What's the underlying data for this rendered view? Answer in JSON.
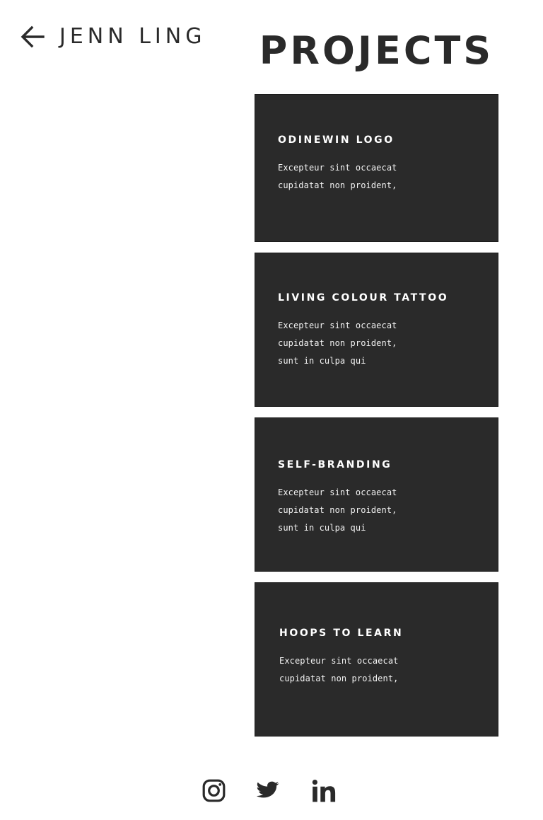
{
  "header": {
    "back_icon": "arrow-left-icon",
    "site_name": "JENN LING"
  },
  "page": {
    "title": "PROJECTS"
  },
  "projects": [
    {
      "title": "ODINEWIN LOGO",
      "description_lines": [
        "Excepteur sint occaecat",
        "cupidatat non proident,"
      ]
    },
    {
      "title": "LIVING COLOUR TATTOO",
      "description_lines": [
        "Excepteur sint occaecat",
        "cupidatat non proident,",
        "sunt in culpa qui"
      ]
    },
    {
      "title": "SELF-BRANDING",
      "description_lines": [
        "Excepteur sint occaecat",
        "cupidatat non proident,",
        "sunt in culpa qui"
      ]
    },
    {
      "title": "HOOPS TO LEARN",
      "description_lines": [
        "Excepteur sint occaecat",
        "cupidatat non proident,"
      ]
    }
  ],
  "social": [
    {
      "name": "instagram",
      "icon": "instagram-icon"
    },
    {
      "name": "twitter",
      "icon": "twitter-icon"
    },
    {
      "name": "linkedin",
      "icon": "linkedin-icon"
    }
  ],
  "colors": {
    "text": "#2a2a2a",
    "card_background": "#2a2a2a",
    "card_text": "#ffffff",
    "background": "#ffffff"
  }
}
